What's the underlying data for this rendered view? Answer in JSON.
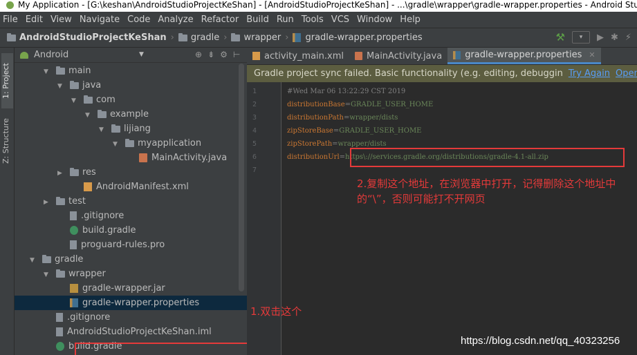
{
  "window": {
    "title": "My Application - [G:\\keshan\\AndroidStudioProjectKeShan] - [AndroidStudioProjectKeShan] - ...\\gradle\\wrapper\\gradle-wrapper.properties - Android Stud"
  },
  "menu": [
    "File",
    "Edit",
    "View",
    "Navigate",
    "Code",
    "Analyze",
    "Refactor",
    "Build",
    "Run",
    "Tools",
    "VCS",
    "Window",
    "Help"
  ],
  "breadcrumb": [
    "AndroidStudioProjectKeShan",
    "gradle",
    "wrapper",
    "gradle-wrapper.properties"
  ],
  "side_tabs": {
    "project": "1: Project",
    "structure": "Z: Structure"
  },
  "project_panel": {
    "view_mode": "Android"
  },
  "tree": [
    {
      "label": "main",
      "depth": 2,
      "expanded": true,
      "icon": "folder"
    },
    {
      "label": "java",
      "depth": 3,
      "expanded": true,
      "icon": "folder"
    },
    {
      "label": "com",
      "depth": 4,
      "expanded": true,
      "icon": "folder"
    },
    {
      "label": "example",
      "depth": 5,
      "expanded": true,
      "icon": "folder"
    },
    {
      "label": "lijiang",
      "depth": 6,
      "expanded": true,
      "icon": "folder"
    },
    {
      "label": "myapplication",
      "depth": 7,
      "expanded": true,
      "icon": "folder"
    },
    {
      "label": "MainActivity.java",
      "depth": 8,
      "icon": "java"
    },
    {
      "label": "res",
      "depth": 3,
      "expanded": false,
      "icon": "folder"
    },
    {
      "label": "AndroidManifest.xml",
      "depth": 4,
      "icon": "xml"
    },
    {
      "label": "test",
      "depth": 2,
      "expanded": false,
      "icon": "folder"
    },
    {
      "label": ".gitignore",
      "depth": 3,
      "icon": "file"
    },
    {
      "label": "build.gradle",
      "depth": 3,
      "icon": "gradle"
    },
    {
      "label": "proguard-rules.pro",
      "depth": 3,
      "icon": "file"
    },
    {
      "label": "gradle",
      "depth": 1,
      "expanded": true,
      "icon": "folder"
    },
    {
      "label": "wrapper",
      "depth": 2,
      "expanded": true,
      "icon": "folder"
    },
    {
      "label": "gradle-wrapper.jar",
      "depth": 3,
      "icon": "jar"
    },
    {
      "label": "gradle-wrapper.properties",
      "depth": 3,
      "icon": "props",
      "selected": true
    },
    {
      "label": ".gitignore",
      "depth": 2,
      "icon": "file"
    },
    {
      "label": "AndroidStudioProjectKeShan.iml",
      "depth": 2,
      "icon": "file"
    },
    {
      "label": "build.gradle",
      "depth": 2,
      "icon": "gradle"
    }
  ],
  "editor_tabs": [
    {
      "label": "activity_main.xml",
      "icon": "xml"
    },
    {
      "label": "MainActivity.java",
      "icon": "java"
    },
    {
      "label": "gradle-wrapper.properties",
      "icon": "props",
      "active": true,
      "closable": true
    }
  ],
  "notification": {
    "text": "Gradle project sync failed. Basic functionality (e.g. editing, debuggin",
    "try_again": "Try Again",
    "open_messages": "Open 'Messag"
  },
  "code_lines": [
    {
      "num": "1",
      "comment": "#Wed Mar 06 13:22:29 CST 2019"
    },
    {
      "num": "2",
      "key": "distributionBase",
      "value": "GRADLE_USER_HOME"
    },
    {
      "num": "3",
      "key": "distributionPath",
      "value": "wrapper/dists"
    },
    {
      "num": "4",
      "key": "zipStoreBase",
      "value": "GRADLE_USER_HOME"
    },
    {
      "num": "5",
      "key": "zipStorePath",
      "value": "wrapper/dists"
    },
    {
      "num": "6",
      "key": "distributionUrl",
      "value": "https\\://services.gradle.org/distributions/gradle-4.1-all.zip"
    },
    {
      "num": "7"
    }
  ],
  "annotations": {
    "step1": "1.双击这个",
    "step2": "2.复制这个地址，在浏览器中打开，记得删除这个地址中的“\\”，否则可能打不开网页"
  },
  "watermark": "https://blog.csdn.net/qq_40323256",
  "colors": {
    "selection": "#0d293e",
    "annotation_red": "#e53a3a",
    "notification_bg": "#5c5d40",
    "link_blue": "#589df6"
  }
}
